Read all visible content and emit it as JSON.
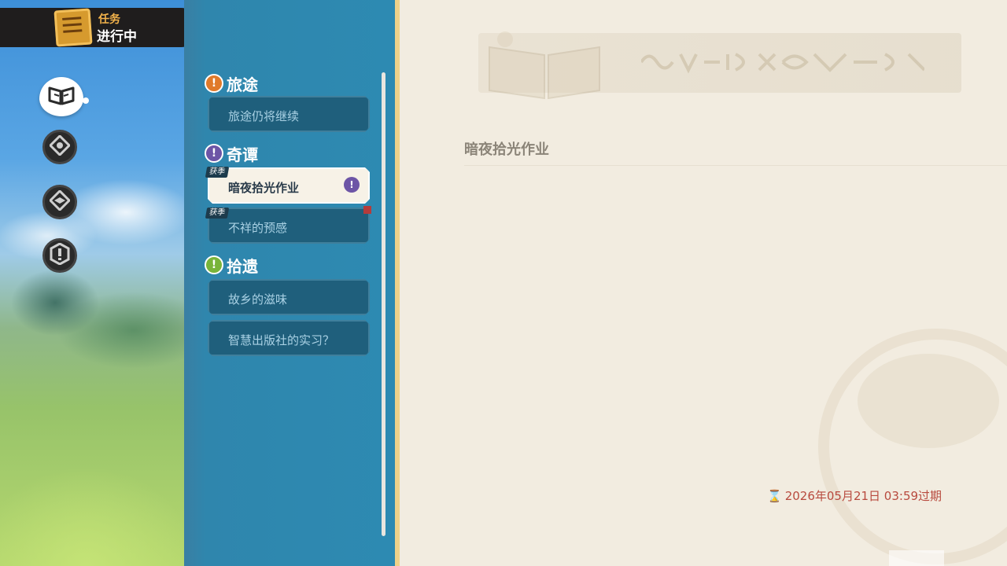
{
  "header": {
    "title_small": "任务",
    "title_large": "进行中"
  },
  "nav": {
    "items": [
      {
        "icon": "book-icon",
        "active": true
      },
      {
        "icon": "compass-icon",
        "active": false
      },
      {
        "icon": "compass-icon",
        "active": false
      },
      {
        "icon": "exclamation-icon",
        "active": false
      }
    ]
  },
  "categories": [
    {
      "label": "旅途",
      "color": "#e07a2a",
      "items": [
        {
          "label": "旅途仍将继续",
          "selected": false
        }
      ]
    },
    {
      "label": "奇谭",
      "color": "#6d55a6",
      "items": [
        {
          "label": "暗夜拾光作业",
          "selected": true,
          "tag": "获季"
        },
        {
          "label": "不祥的预感",
          "selected": false,
          "tag": "获季"
        }
      ]
    },
    {
      "label": "拾遗",
      "color": "#79b43a",
      "items": [
        {
          "label": "故乡的滋味",
          "selected": false
        },
        {
          "label": "智慧出版社的实习？",
          "selected": false
        }
      ]
    }
  ],
  "detail": {
    "title": "暗夜拾光作业",
    "expire_text": "2026年05月21日 03:59过期"
  },
  "colors": {
    "panel": "#2d8ab2",
    "item_bg": "#1f5f7c",
    "expire": "#b84a3e"
  }
}
